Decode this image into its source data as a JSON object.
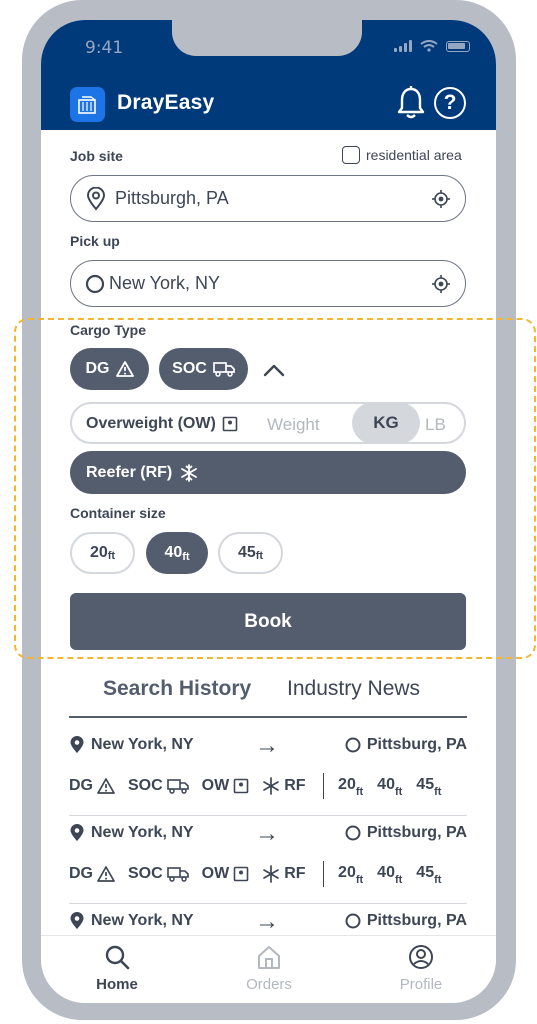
{
  "status_bar": {
    "time": "9:41"
  },
  "app": {
    "title": "DrayEasy"
  },
  "form": {
    "job_site_label": "Job site",
    "residential_label": "residential area",
    "job_site_value": "Pittsburgh, PA",
    "pickup_label": "Pick up",
    "pickup_value": "New York, NY",
    "cargo_type_label": "Cargo Type",
    "cargo_dg": "DG",
    "cargo_soc": "SOC",
    "overweight_label": "Overweight (OW)",
    "weight_placeholder": "Weight",
    "unit_kg": "KG",
    "unit_lb": "LB",
    "reefer_label": "Reefer (RF)",
    "container_size_label": "Container size",
    "sizes": [
      {
        "num": "20",
        "unit": "ft",
        "selected": false
      },
      {
        "num": "40",
        "unit": "ft",
        "selected": true
      },
      {
        "num": "45",
        "unit": "ft",
        "selected": false
      }
    ],
    "book_label": "Book"
  },
  "tabs": [
    {
      "label": "Search History",
      "active": true
    },
    {
      "label": "Industry News",
      "active": false
    }
  ],
  "history": [
    {
      "from": "New York, NY",
      "arrow": "→",
      "to": "Pittsburg, PA",
      "dg": "DG",
      "soc": "SOC",
      "ow": "OW",
      "rf": "RF",
      "s20": "20",
      "s40": "40",
      "s45": "45",
      "unit": "ft"
    },
    {
      "from": "New York, NY",
      "arrow": "→",
      "to": "Pittsburg, PA",
      "dg": "DG",
      "soc": "SOC",
      "ow": "OW",
      "rf": "RF",
      "s20": "20",
      "s40": "40",
      "s45": "45",
      "unit": "ft"
    },
    {
      "from": "New York, NY",
      "arrow": "→",
      "to": "Pittsburg, PA"
    }
  ],
  "nav": [
    {
      "label": "Home",
      "icon": "search-icon",
      "active": true
    },
    {
      "label": "Orders",
      "icon": "home-icon",
      "active": false
    },
    {
      "label": "Profile",
      "icon": "profile-icon",
      "active": false
    }
  ],
  "colors": {
    "header": "#003a7a",
    "accent": "#1c74e6",
    "dark_pill": "#545d6d",
    "highlight_dash": "#f2b632",
    "frame": "#b8bcc4"
  }
}
